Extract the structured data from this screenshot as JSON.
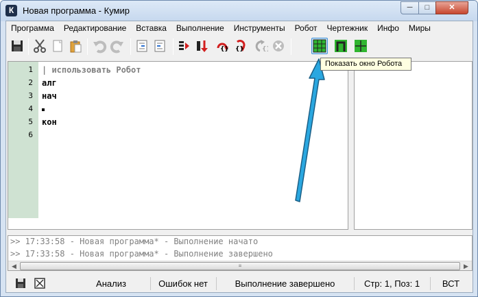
{
  "window": {
    "title": "Новая программа - Кумир",
    "icon_letter": "К"
  },
  "menu": [
    "Программа",
    "Редактирование",
    "Вставка",
    "Выполнение",
    "Инструменты",
    "Робот",
    "Чертежник",
    "Инфо",
    "Миры"
  ],
  "toolbar": {
    "buttons": [
      "save-icon",
      "cut-icon",
      "copy-icon",
      "paste-icon",
      "undo-icon",
      "redo-icon",
      "indent-icon",
      "unindent-icon",
      "run-icon",
      "run-step-icon",
      "step-over-icon",
      "step-into-icon",
      "step-out-icon",
      "stop-icon",
      "robot-grid-icon",
      "robot-frame-icon",
      "robot-cross-icon"
    ],
    "tooltip": "Показать окно Робота"
  },
  "editor": {
    "line_numbers": [
      "1",
      "2",
      "3",
      "4",
      "5",
      "6"
    ],
    "lines": [
      "| использовать Робот",
      "алг",
      "нач",
      "",
      "кон",
      ""
    ]
  },
  "console": {
    "lines": [
      ">> 17:33:58 - Новая программа* - Выполнение начато",
      ">> 17:33:58 - Новая программа* - Выполнение завершено"
    ]
  },
  "status": {
    "analysis": "Анализ",
    "errors": "Ошибок нет",
    "execution": "Выполнение завершено",
    "position": "Стр: 1, Поз: 1",
    "mode": "ВСТ"
  },
  "colors": {
    "gutter": "#cfe2d2",
    "accent_arrow": "#2aa7e0",
    "robot_icon": "#2fb52f",
    "tooltip_bg": "#ffffe1"
  }
}
